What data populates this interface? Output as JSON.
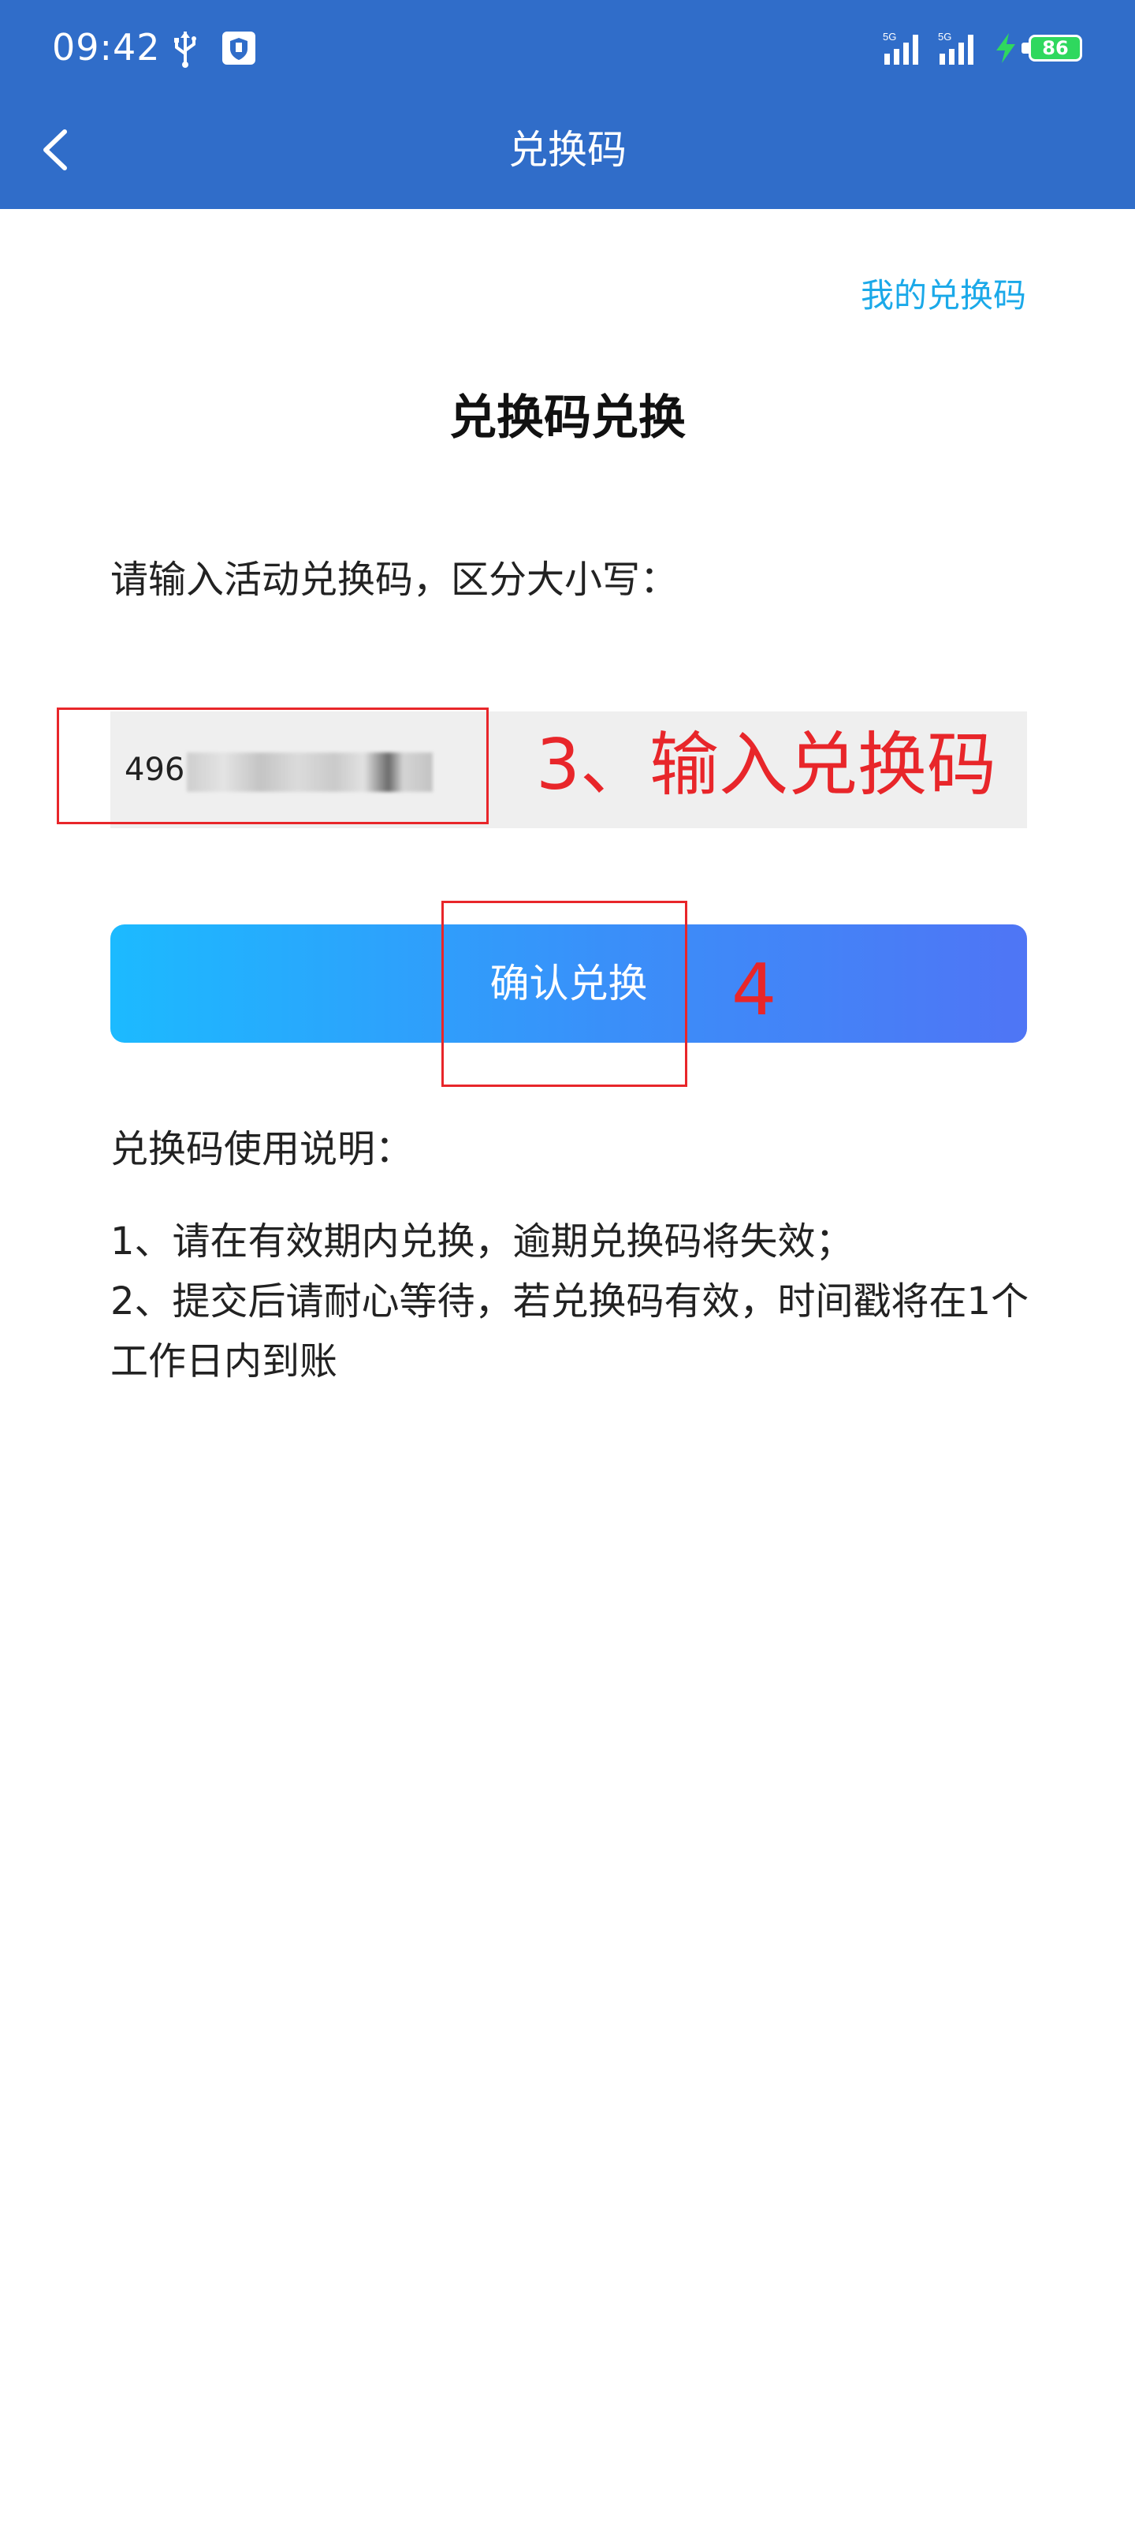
{
  "status_bar": {
    "time": "09:42",
    "signal_1_label": "5G",
    "signal_2_label": "5G",
    "battery_level": "86",
    "icons": [
      "usb-icon",
      "shield-icon",
      "signal-icon",
      "signal-icon",
      "charging-icon",
      "battery-icon"
    ]
  },
  "nav": {
    "title": "兑换码",
    "back_icon": "chevron-left-icon"
  },
  "my_codes_link": "我的兑换码",
  "section_title": "兑换码兑换",
  "prompt": "请输入活动兑换码，区分大小写：",
  "code_input": {
    "value_prefix": "496"
  },
  "confirm_button": "确认兑换",
  "annotations": {
    "step3": "3、输入兑换码",
    "step4": "4",
    "color": "#e8262a"
  },
  "usage": {
    "title": "兑换码使用说明：",
    "items": [
      "1、请在有效期内兑换，逾期兑换码将失效；",
      "2、提交后请耐心等待，若兑换码有效，时间戳将在1个工作日内到账"
    ]
  },
  "colors": {
    "header_bg": "#306dc9",
    "link": "#1ba9e9",
    "button_gradient_start": "#1cbaff",
    "button_gradient_end": "#4f75f5",
    "input_bg": "#efefef"
  }
}
